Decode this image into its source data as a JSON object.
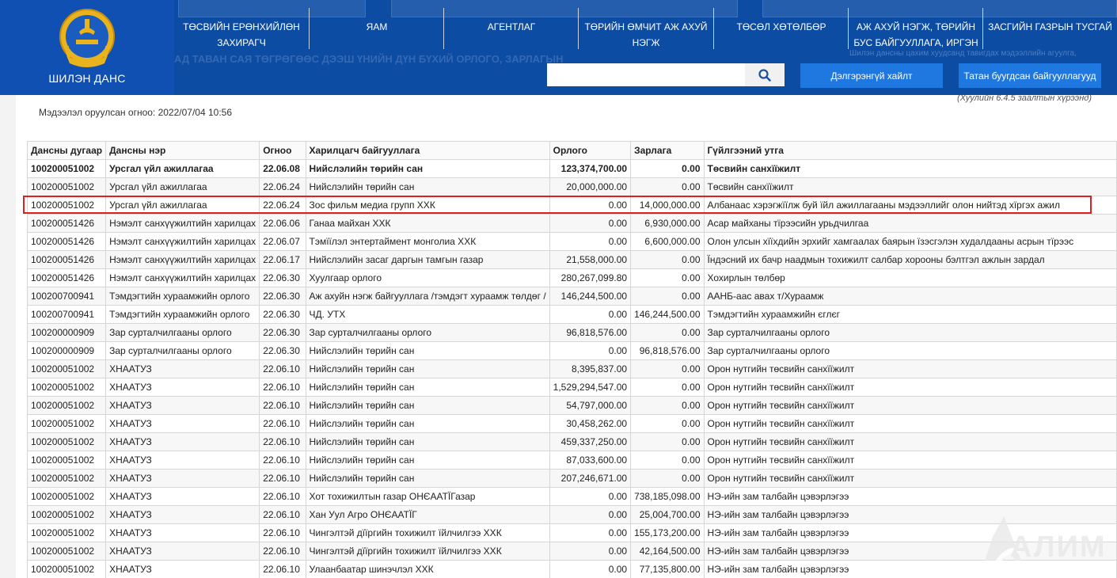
{
  "header": {
    "logo_text": "ШИЛЭН ДАНС",
    "nav": [
      {
        "label": "ТӨСВИЙН ЕРӨНХИЙЛӨН ЗАХИРАГЧ"
      },
      {
        "label": "ЯАМ"
      },
      {
        "label": "АГЕНТЛАГ"
      },
      {
        "label": "ТӨРИЙН ӨМЧИТ АЖ АХУЙ НЭГЖ"
      },
      {
        "label": "ТӨСӨЛ ХӨТӨЛБӨР"
      },
      {
        "label": "АЖ АХУЙ НЭГЖ, ТӨРИЙН БУС БАЙГУУЛЛАГА, ИРГЭН"
      },
      {
        "label": "ЗАСГИЙН ГАЗРЫН ТУСГАЙ"
      }
    ],
    "bg_heading": "АД ТАВАН САЯ ТӨГРӨГӨӨС ДЭЭШ ҮНИЙН ДҮН БҮХИЙ ОРЛОГО, ЗАРЛАГЫН",
    "bg_note": "Шилэн дансны цахим хуудсанд тавигдах мэдээллийн агуулга,",
    "search": {
      "placeholder": "",
      "value": ""
    },
    "advanced_search_label": "Дэлгэрэнгүй хайлт",
    "subsidiary_label": "Татан буугдсан байгууллагууд"
  },
  "content": {
    "updated": "Мэдээлэл оруулсан огноо: 2022/07/04 10:56",
    "law_note": "(Хуулийн 6.4.5 заалтын хүрээнд)"
  },
  "table": {
    "headers": [
      "Дансны дугаар",
      "Дансны нэр",
      "Огноо",
      "Харилцагч байгууллага",
      "Орлого",
      "Зарлага",
      "Гүйлгээний утга"
    ],
    "rows": [
      [
        "100200051002",
        "Урсгал үйл ажиллагаа",
        "22.06.08",
        "Нийслэлийн төрийн сан",
        "123,374,700.00",
        "0.00",
        "Төсвийн санхїїжилт"
      ],
      [
        "100200051002",
        "Урсгал үйл ажиллагаа",
        "22.06.24",
        "Нийслэлийн төрийн сан",
        "20,000,000.00",
        "0.00",
        "Төсвийн санхїїжилт"
      ],
      [
        "100200051002",
        "Урсгал үйл ажиллагаа",
        "22.06.24",
        "Зос фильм медиа групп ХХК",
        "0.00",
        "14,000,000.00",
        "Албанаас хэрэгжїїлж буй їйл ажиллагааны мэдээллийг олон нийтэд хїргэх ажил"
      ],
      [
        "100200051426",
        "Нэмэлт санхүүжилтийн харилцах",
        "22.06.06",
        "Ганаа майхан ХХК",
        "0.00",
        "6,930,000.00",
        "Асар майханы тїрээсийн урьдчилгаа"
      ],
      [
        "100200051426",
        "Нэмэлт санхүүжилтийн харилцах",
        "22.06.07",
        "Тэмїїлэл энтертаймент монголиа ХХК",
        "0.00",
        "6,600,000.00",
        "Олон улсын хїїхдийн эрхийг хамгаалах баярын їзэсгэлэн худалдааны асрын тїрээс"
      ],
      [
        "100200051426",
        "Нэмэлт санхүүжилтийн харилцах",
        "22.06.17",
        "Нийслэлийн засаг даргын тамгын газар",
        "21,558,000.00",
        "0.00",
        "Їндэсний их бачр наадмын тохижилт салбар хорооны бэлтгэл ажлын зардал"
      ],
      [
        "100200051426",
        "Нэмэлт санхүүжилтийн харилцах",
        "22.06.30",
        "Хуулгаар орлого",
        "280,267,099.80",
        "0.00",
        "Хохирлын төлбөр"
      ],
      [
        "100200700941",
        "Тэмдэгтийн хураамжийн орлого",
        "22.06.30",
        "Аж ахуйн нэгж байгууллага /тэмдэгт хураамж төлдөг /",
        "146,244,500.00",
        "0.00",
        "ААНБ-аас авах т/Хураамж"
      ],
      [
        "100200700941",
        "Тэмдэгтийн хураамжийн орлого",
        "22.06.30",
        "ЧД. УТХ",
        "0.00",
        "146,244,500.00",
        "Тэмдэгтийн хураамжийн єглєг"
      ],
      [
        "100200000909",
        "Зар сурталчилгааны орлого",
        "22.06.30",
        "Зар сурталчилгааны орлого",
        "96,818,576.00",
        "0.00",
        "Зар сурталчилгааны орлого"
      ],
      [
        "100200000909",
        "Зар сурталчилгааны орлого",
        "22.06.30",
        "Нийслэлийн төрийн сан",
        "0.00",
        "96,818,576.00",
        "Зар сурталчилгааны орлого"
      ],
      [
        "100200051002",
        "ХНААТУЗ",
        "22.06.10",
        "Нийслэлийн төрийн сан",
        "8,395,837.00",
        "0.00",
        "Орон нутгийн төсвийн санхїїжилт"
      ],
      [
        "100200051002",
        "ХНААТУЗ",
        "22.06.10",
        "Нийслэлийн төрийн сан",
        "1,529,294,547.00",
        "0.00",
        "Орон нутгийн төсвийн санхїїжилт"
      ],
      [
        "100200051002",
        "ХНААТУЗ",
        "22.06.10",
        "Нийслэлийн төрийн сан",
        "54,797,000.00",
        "0.00",
        "Орон нутгийн төсвийн санхїїжилт"
      ],
      [
        "100200051002",
        "ХНААТУЗ",
        "22.06.10",
        "Нийслэлийн төрийн сан",
        "30,458,262.00",
        "0.00",
        "Орон нутгийн төсвийн санхїїжилт"
      ],
      [
        "100200051002",
        "ХНААТУЗ",
        "22.06.10",
        "Нийслэлийн төрийн сан",
        "459,337,250.00",
        "0.00",
        "Орон нутгийн төсвийн санхїїжилт"
      ],
      [
        "100200051002",
        "ХНААТУЗ",
        "22.06.10",
        "Нийслэлийн төрийн сан",
        "87,033,600.00",
        "0.00",
        "Орон нутгийн төсвийн санхїїжилт"
      ],
      [
        "100200051002",
        "ХНААТУЗ",
        "22.06.10",
        "Нийслэлийн төрийн сан",
        "207,246,671.00",
        "0.00",
        "Орон нутгийн төсвийн санхїїжилт"
      ],
      [
        "100200051002",
        "ХНААТУЗ",
        "22.06.10",
        "Хот тохижилтын газар ОНЄААТЇГазар",
        "0.00",
        "738,185,098.00",
        "НЭ-ийн зам талбайн цэвэрлэгээ"
      ],
      [
        "100200051002",
        "ХНААТУЗ",
        "22.06.10",
        "Хан Уул Агро ОНЄААТЇГ",
        "0.00",
        "25,004,700.00",
        "НЭ-ийн зам талбайн цэвэрлэгээ"
      ],
      [
        "100200051002",
        "ХНААТУЗ",
        "22.06.10",
        "Чингэлтэй дїїргийн тохижилт їйлчилгээ ХХК",
        "0.00",
        "155,173,200.00",
        "НЭ-ийн зам талбайн цэвэрлэгээ"
      ],
      [
        "100200051002",
        "ХНААТУЗ",
        "22.06.10",
        "Чингэлтэй дїїргийн тохижилт їйлчилгээ ХХК",
        "0.00",
        "42,164,500.00",
        "НЭ-ийн зам талбайн цэвэрлэгээ"
      ],
      [
        "100200051002",
        "ХНААТУЗ",
        "22.06.10",
        "Улаанбаатар шинэчлэл ХХК",
        "0.00",
        "77,135,800.00",
        "НЭ-ийн зам талбайн цэвэрлэгээ"
      ]
    ]
  },
  "watermark": {
    "text": "АЛИМ"
  },
  "colors": {
    "header_bg": "#0d4ca3",
    "button_blue": "#1f77e0",
    "highlight_red": "#e02020"
  }
}
